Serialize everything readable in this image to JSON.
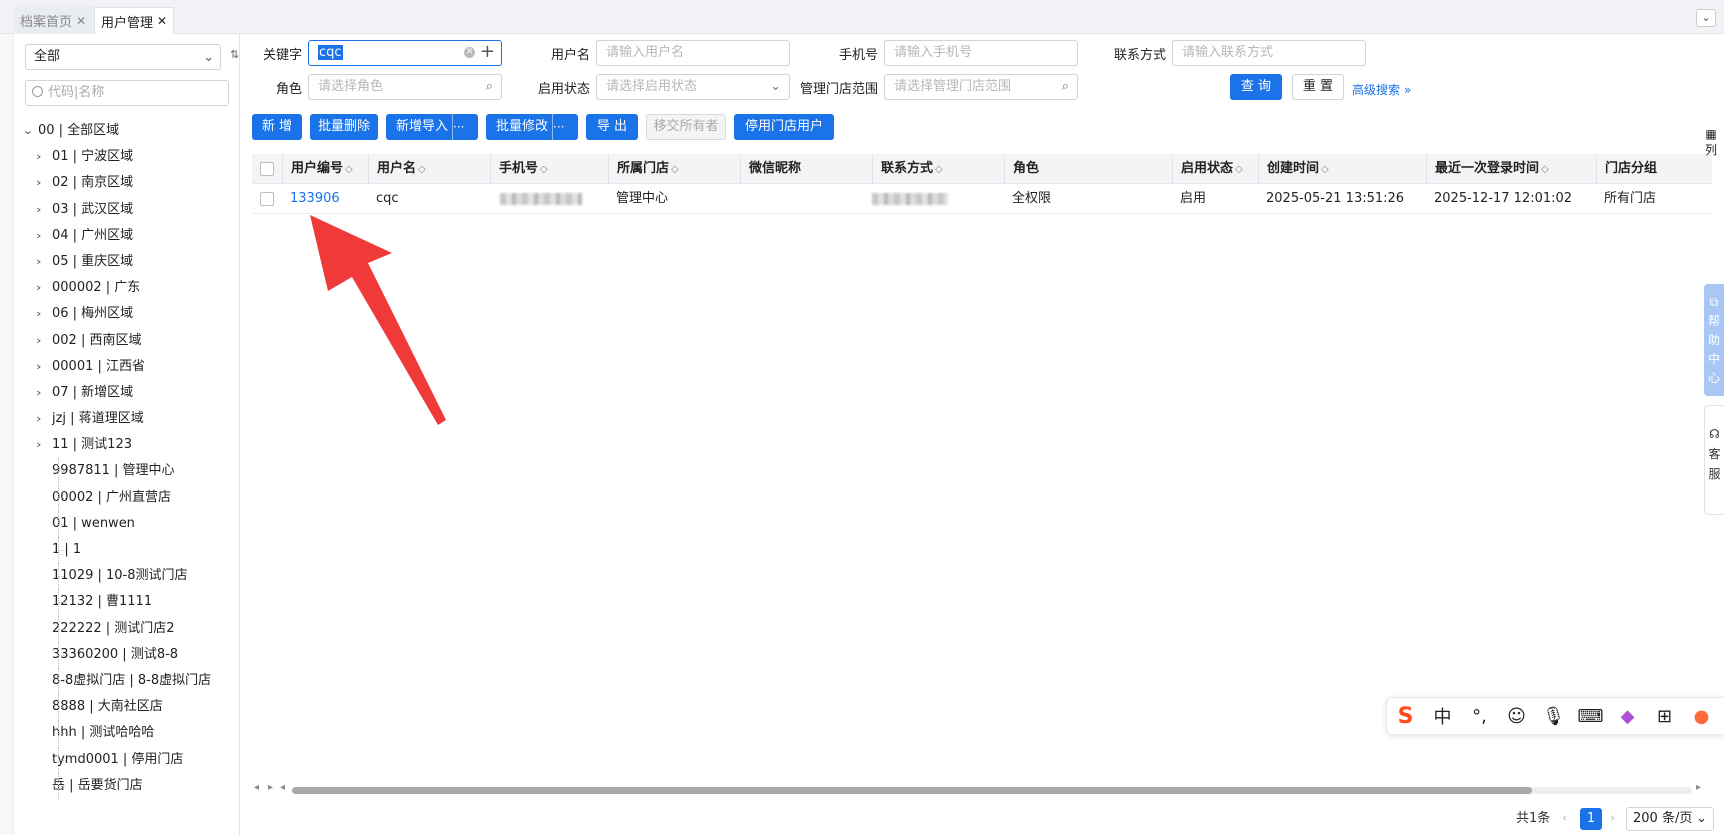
{
  "tabs": [
    {
      "label": "档案首页",
      "close": "✕"
    },
    {
      "label": "用户管理",
      "close": "✕"
    }
  ],
  "sidebar": {
    "scope_select": "全部",
    "search_placeholder": "代码|名称",
    "root": "00 | 全部区域",
    "branches": [
      "01 | 宁波区域",
      "02 | 南京区域",
      "03 | 武汉区域",
      "04 | 广州区域",
      "05 | 重庆区域",
      "000002 | 广东",
      "06 | 梅州区域",
      "002 | 西南区域",
      "00001 | 江西省",
      "07 | 新增区域",
      "jzj | 蒋道理区域",
      "11 | 测试123"
    ],
    "leaves": [
      "9987811 | 管理中心",
      "00002 | 广州直营店",
      "01 | wenwen",
      "1 | 1",
      "11029 | 10-8测试门店",
      "12132 | 曹1111",
      "222222 | 测试门店2",
      "33360200 | 测试8-8",
      "8-8虚拟门店 | 8-8虚拟门店",
      "8888 | 大南社区店",
      "hhh | 测试哈哈哈",
      "tymd0001 | 停用门店",
      "岳 | 岳要货门店"
    ]
  },
  "filters": {
    "keyword_label": "关键字",
    "keyword_value": "cqc",
    "username_label": "用户名",
    "username_placeholder": "请输入用户名",
    "phone_label": "手机号",
    "phone_placeholder": "请输入手机号",
    "contact_label": "联系方式",
    "contact_placeholder": "请输入联系方式",
    "role_label": "角色",
    "role_placeholder": "请选择角色",
    "status_label": "启用状态",
    "status_placeholder": "请选择启用状态",
    "store_label": "管理门店范围",
    "store_placeholder": "请选择管理门店范围",
    "query": "查 询",
    "reset": "重 置",
    "advanced": "高级搜索"
  },
  "toolbar": {
    "add": "新 增",
    "batch_delete": "批量删除",
    "import": "新增导入",
    "more": "···",
    "batch_edit": "批量修改",
    "export": "导 出",
    "transfer_owner": "移交所有者",
    "disable_store_user": "停用门店用户"
  },
  "table": {
    "headers": [
      "用户编号",
      "用户名",
      "手机号",
      "所属门店",
      "微信昵称",
      "联系方式",
      "角色",
      "启用状态",
      "创建时间",
      "最近一次登录时间",
      "门店分组"
    ],
    "sort_mark": "◇",
    "row": {
      "id": "133906",
      "username": "cqc",
      "store": "管理中心",
      "wechat": "",
      "role": "全权限",
      "status": "启用",
      "created": "2025-05-21 13:51:26",
      "last_login": "2025-12-17 12:01:02",
      "group": "所有门店"
    }
  },
  "right_panel": {
    "columns": "列",
    "help": "帮助中心",
    "service": "客服"
  },
  "pagination": {
    "total": "共1条",
    "page": "1",
    "page_size": "200 条/页"
  },
  "colors": {
    "primary": "#1a73e8",
    "annotation_arrow": "#f03a3a"
  }
}
